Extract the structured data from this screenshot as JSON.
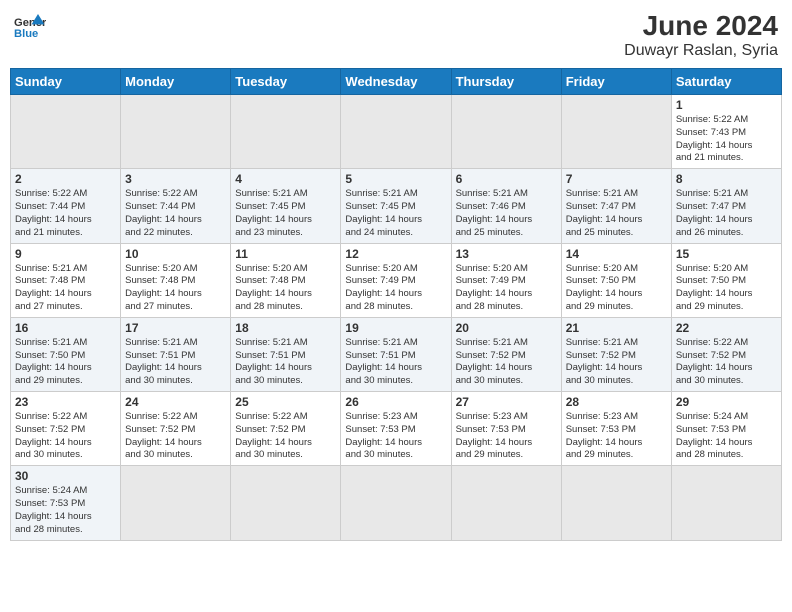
{
  "header": {
    "logo_general": "General",
    "logo_blue": "Blue",
    "month": "June 2024",
    "location": "Duwayr Raslan, Syria"
  },
  "weekdays": [
    "Sunday",
    "Monday",
    "Tuesday",
    "Wednesday",
    "Thursday",
    "Friday",
    "Saturday"
  ],
  "weeks": [
    [
      {
        "day": "",
        "info": "",
        "empty": true
      },
      {
        "day": "",
        "info": "",
        "empty": true
      },
      {
        "day": "",
        "info": "",
        "empty": true
      },
      {
        "day": "",
        "info": "",
        "empty": true
      },
      {
        "day": "",
        "info": "",
        "empty": true
      },
      {
        "day": "",
        "info": "",
        "empty": true
      },
      {
        "day": "1",
        "info": "Sunrise: 5:22 AM\nSunset: 7:43 PM\nDaylight: 14 hours\nand 21 minutes."
      }
    ],
    [
      {
        "day": "2",
        "info": "Sunrise: 5:22 AM\nSunset: 7:44 PM\nDaylight: 14 hours\nand 21 minutes."
      },
      {
        "day": "3",
        "info": "Sunrise: 5:22 AM\nSunset: 7:44 PM\nDaylight: 14 hours\nand 22 minutes."
      },
      {
        "day": "4",
        "info": "Sunrise: 5:21 AM\nSunset: 7:45 PM\nDaylight: 14 hours\nand 23 minutes."
      },
      {
        "day": "5",
        "info": "Sunrise: 5:21 AM\nSunset: 7:45 PM\nDaylight: 14 hours\nand 24 minutes."
      },
      {
        "day": "6",
        "info": "Sunrise: 5:21 AM\nSunset: 7:46 PM\nDaylight: 14 hours\nand 25 minutes."
      },
      {
        "day": "7",
        "info": "Sunrise: 5:21 AM\nSunset: 7:47 PM\nDaylight: 14 hours\nand 25 minutes."
      },
      {
        "day": "8",
        "info": "Sunrise: 5:21 AM\nSunset: 7:47 PM\nDaylight: 14 hours\nand 26 minutes."
      }
    ],
    [
      {
        "day": "9",
        "info": "Sunrise: 5:21 AM\nSunset: 7:48 PM\nDaylight: 14 hours\nand 27 minutes."
      },
      {
        "day": "10",
        "info": "Sunrise: 5:20 AM\nSunset: 7:48 PM\nDaylight: 14 hours\nand 27 minutes."
      },
      {
        "day": "11",
        "info": "Sunrise: 5:20 AM\nSunset: 7:48 PM\nDaylight: 14 hours\nand 28 minutes."
      },
      {
        "day": "12",
        "info": "Sunrise: 5:20 AM\nSunset: 7:49 PM\nDaylight: 14 hours\nand 28 minutes."
      },
      {
        "day": "13",
        "info": "Sunrise: 5:20 AM\nSunset: 7:49 PM\nDaylight: 14 hours\nand 28 minutes."
      },
      {
        "day": "14",
        "info": "Sunrise: 5:20 AM\nSunset: 7:50 PM\nDaylight: 14 hours\nand 29 minutes."
      },
      {
        "day": "15",
        "info": "Sunrise: 5:20 AM\nSunset: 7:50 PM\nDaylight: 14 hours\nand 29 minutes."
      }
    ],
    [
      {
        "day": "16",
        "info": "Sunrise: 5:21 AM\nSunset: 7:50 PM\nDaylight: 14 hours\nand 29 minutes."
      },
      {
        "day": "17",
        "info": "Sunrise: 5:21 AM\nSunset: 7:51 PM\nDaylight: 14 hours\nand 30 minutes."
      },
      {
        "day": "18",
        "info": "Sunrise: 5:21 AM\nSunset: 7:51 PM\nDaylight: 14 hours\nand 30 minutes."
      },
      {
        "day": "19",
        "info": "Sunrise: 5:21 AM\nSunset: 7:51 PM\nDaylight: 14 hours\nand 30 minutes."
      },
      {
        "day": "20",
        "info": "Sunrise: 5:21 AM\nSunset: 7:52 PM\nDaylight: 14 hours\nand 30 minutes."
      },
      {
        "day": "21",
        "info": "Sunrise: 5:21 AM\nSunset: 7:52 PM\nDaylight: 14 hours\nand 30 minutes."
      },
      {
        "day": "22",
        "info": "Sunrise: 5:22 AM\nSunset: 7:52 PM\nDaylight: 14 hours\nand 30 minutes."
      }
    ],
    [
      {
        "day": "23",
        "info": "Sunrise: 5:22 AM\nSunset: 7:52 PM\nDaylight: 14 hours\nand 30 minutes."
      },
      {
        "day": "24",
        "info": "Sunrise: 5:22 AM\nSunset: 7:52 PM\nDaylight: 14 hours\nand 30 minutes."
      },
      {
        "day": "25",
        "info": "Sunrise: 5:22 AM\nSunset: 7:52 PM\nDaylight: 14 hours\nand 30 minutes."
      },
      {
        "day": "26",
        "info": "Sunrise: 5:23 AM\nSunset: 7:53 PM\nDaylight: 14 hours\nand 30 minutes."
      },
      {
        "day": "27",
        "info": "Sunrise: 5:23 AM\nSunset: 7:53 PM\nDaylight: 14 hours\nand 29 minutes."
      },
      {
        "day": "28",
        "info": "Sunrise: 5:23 AM\nSunset: 7:53 PM\nDaylight: 14 hours\nand 29 minutes."
      },
      {
        "day": "29",
        "info": "Sunrise: 5:24 AM\nSunset: 7:53 PM\nDaylight: 14 hours\nand 28 minutes."
      }
    ],
    [
      {
        "day": "30",
        "info": "Sunrise: 5:24 AM\nSunset: 7:53 PM\nDaylight: 14 hours\nand 28 minutes."
      },
      {
        "day": "",
        "info": "",
        "empty": true
      },
      {
        "day": "",
        "info": "",
        "empty": true
      },
      {
        "day": "",
        "info": "",
        "empty": true
      },
      {
        "day": "",
        "info": "",
        "empty": true
      },
      {
        "day": "",
        "info": "",
        "empty": true
      },
      {
        "day": "",
        "info": "",
        "empty": true
      }
    ]
  ]
}
